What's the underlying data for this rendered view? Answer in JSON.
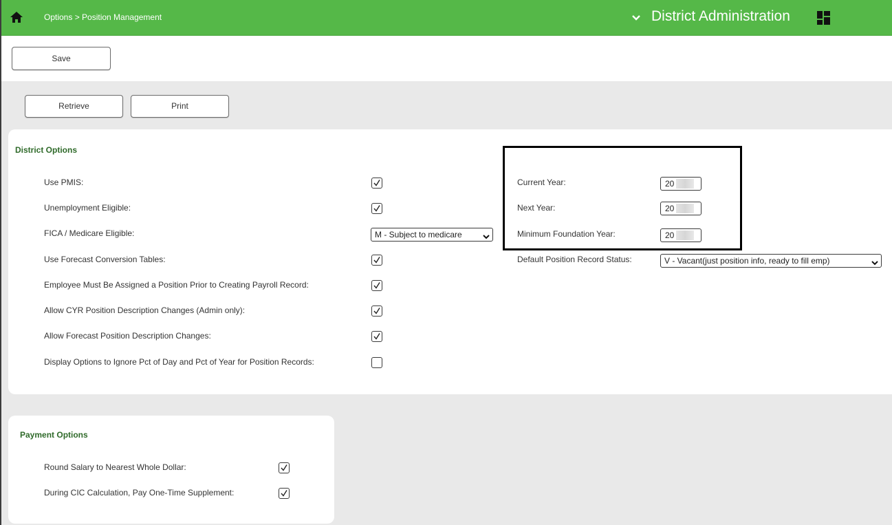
{
  "header": {
    "breadcrumb": "Options > Position Management",
    "app_title": "District Administration",
    "bar_color": "#55b848"
  },
  "toolbar": {
    "save_label": "Save",
    "retrieve_label": "Retrieve",
    "print_label": "Print"
  },
  "district_options": {
    "heading": "District Options",
    "items": [
      {
        "label": "Use PMIS:",
        "checked": true
      },
      {
        "label": "Unemployment Eligible:",
        "checked": true
      },
      {
        "label": "FICA / Medicare Eligible:",
        "select_value": "M - Subject to medicare"
      },
      {
        "label": "Use Forecast Conversion Tables:",
        "checked": true
      },
      {
        "label": "Employee Must Be Assigned a Position Prior to Creating Payroll Record:",
        "checked": true
      },
      {
        "label": "Allow CYR Position Description Changes (Admin only):",
        "checked": true
      },
      {
        "label": "Allow Forecast Position Description Changes:",
        "checked": true
      },
      {
        "label": "Display Options to Ignore Pct of Day and Pct of Year for Position Records:",
        "checked": false
      }
    ],
    "years": [
      {
        "label": "Current Year:",
        "value": "20"
      },
      {
        "label": "Next Year:",
        "value": "20"
      },
      {
        "label": "Minimum Foundation Year:",
        "value": "20"
      }
    ],
    "default_status": {
      "label": "Default Position Record Status:",
      "value": "V - Vacant(just position info, ready to fill emp)"
    }
  },
  "payment_options": {
    "heading": "Payment Options",
    "items": [
      {
        "label": "Round Salary to Nearest Whole Dollar:",
        "checked": true
      },
      {
        "label": "During CIC Calculation, Pay One-Time Supplement:",
        "checked": true
      }
    ]
  }
}
